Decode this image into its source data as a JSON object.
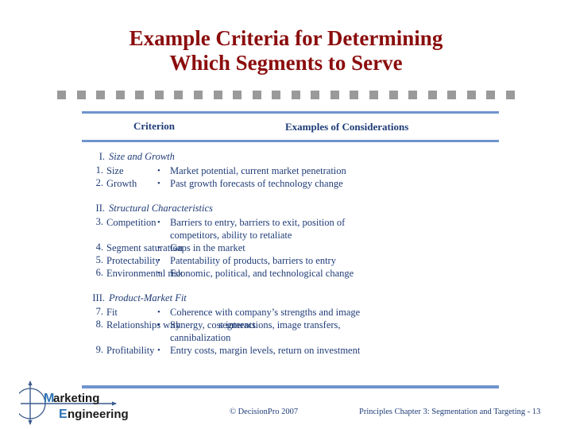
{
  "slide": {
    "title_lines": [
      "Example Criteria for Determining",
      "Which Segments to Serve"
    ],
    "title_color": "#8B0D0D",
    "accent_rule_color": "#6F94CD",
    "body_text_color": "#1F3C77",
    "dash_color": "#9A9A9A",
    "dash_count": 24
  },
  "table": {
    "headers": {
      "criterion": "Criterion",
      "considerations": "Examples of Considerations"
    },
    "sections": [
      {
        "numeral": "I.",
        "title": "Size and Growth",
        "rows": [
          {
            "number": "1.",
            "criterion": "Size",
            "considerations": [
              "Market potential, current market penetration"
            ]
          },
          {
            "number": "2.",
            "criterion": "Growth",
            "considerations": [
              "Past growth forecasts of technology change"
            ]
          }
        ]
      },
      {
        "numeral": "II.",
        "title": "Structural Characteristics",
        "rows": [
          {
            "number": "3.",
            "criterion": "Competition",
            "considerations": [
              "Barriers to entry, barriers to exit, position of"
            ],
            "considerations_cont": [
              "competitors, ability to retaliate"
            ]
          },
          {
            "number": "4.",
            "criterion": "Segment saturation",
            "considerations": [
              "Gaps in the market"
            ]
          },
          {
            "number": "5.",
            "criterion": "Protectability",
            "considerations": [
              "Patentability of products, barriers to entry"
            ]
          },
          {
            "number": "6.",
            "criterion": "Environmental risk",
            "considerations": [
              "Economic, political, and technological change"
            ]
          }
        ]
      },
      {
        "numeral": "III.",
        "title": "Product-Market Fit",
        "rows": [
          {
            "number": "7.",
            "criterion": "Fit",
            "considerations": [
              "Coherence with company’s strengths and image"
            ]
          },
          {
            "number": "8.",
            "criterion": "Relationships with",
            "criterion_cont": "segments",
            "considerations": [
              "Synergy, cost interactions, image transfers,"
            ],
            "considerations_cont": [
              "cannibalization"
            ]
          },
          {
            "number": "9.",
            "criterion": "Profitability",
            "considerations": [
              "Entry costs, margin levels, return on investment"
            ]
          }
        ]
      }
    ]
  },
  "logo": {
    "word_top": "arketing",
    "word_top_initial": "M",
    "word_bottom": "ngineering",
    "word_bottom_initial": "E",
    "initial_color": "#2E74B5",
    "word_color": "#1A1A1A"
  },
  "footer": {
    "copyright": "©  DecisionPro 2007",
    "reference": "Principles Chapter 3: Segmentation and Targeting - 13"
  }
}
